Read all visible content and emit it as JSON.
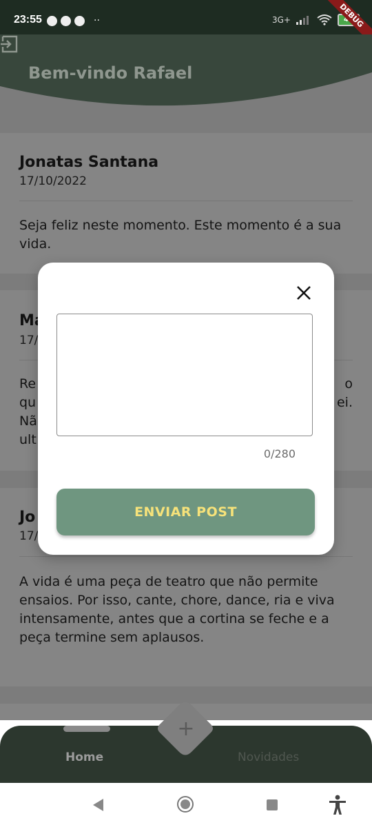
{
  "status_bar": {
    "time": "23:55",
    "more_indicator": "··",
    "network": "3G+",
    "battery": "46",
    "debug_banner": "DEBUG"
  },
  "header": {
    "title": "Bem-vindo Rafael",
    "logout_icon": "logout-icon"
  },
  "posts": [
    {
      "author": "Jonatas Santana",
      "date": "17/10/2022",
      "body": "Seja feliz neste momento. Este momento é a sua vida."
    },
    {
      "author": "Ma",
      "date": "17/1",
      "body_lines": [
        "Re",
        "qu",
        "Nã",
        "ult"
      ],
      "body_right_fragments": [
        "o",
        "ei."
      ]
    },
    {
      "author": "Jo",
      "date": "17/1",
      "body": "A vida é uma peça de teatro que não permite ensaios. Por isso, cante, chore, dance, ria e viva intensamente, antes que a cortina se feche e a peça termine sem aplausos."
    }
  ],
  "modal": {
    "close_icon": "close-icon",
    "textarea_value": "",
    "char_counter": "0/280",
    "send_button_label": "ENVIAR POST"
  },
  "bottom_nav": {
    "home_label": "Home",
    "news_label": "Novidades",
    "fab_icon": "plus-icon",
    "fab_symbol": "+"
  },
  "colors": {
    "header_green": "#38473c",
    "button_green": "#6f9680",
    "button_text": "#f6e27a"
  }
}
